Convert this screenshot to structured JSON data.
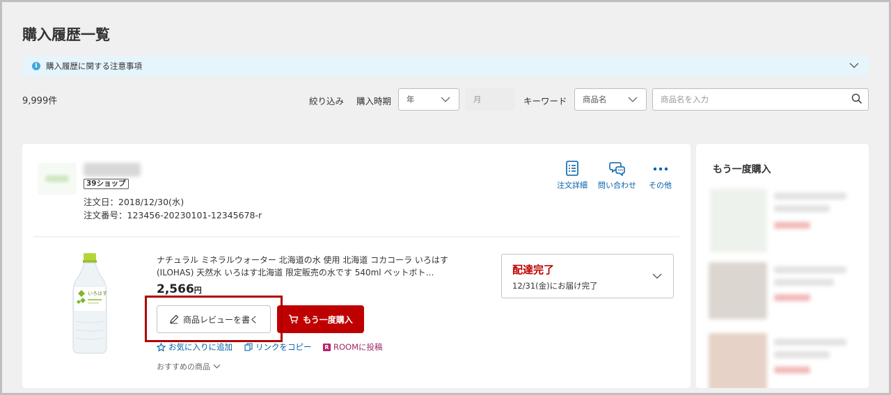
{
  "page": {
    "title": "購入履歴一覧"
  },
  "notice": {
    "text": "購入履歴に関する注意事項"
  },
  "count": "9,999件",
  "filters": {
    "narrow_label": "絞り込み",
    "period_label": "購入時期",
    "year_value": "年",
    "month_value": "月",
    "keyword_label": "キーワード",
    "keyword_type": "商品名",
    "search_placeholder": "商品名を入力"
  },
  "order": {
    "shop_badge": "39ショップ",
    "date": "注文日：2018/12/30(水)",
    "number": "注文番号：123456-20230101-12345678-r",
    "actions": [
      {
        "label": "注文詳細",
        "icon": "document-icon"
      },
      {
        "label": "問い合わせ",
        "icon": "chat-icon"
      },
      {
        "label": "その他",
        "icon": "more-icon"
      }
    ],
    "item": {
      "name": "ナチュラル ミネラルウォーター 北海道の水 使用 北海道 コカコーラ いろはす(ILOHAS) 天然水 いろはす北海道 限定販売の水です 540ml ペットボト…",
      "price": "2,566",
      "price_unit": "円",
      "bottle_label": "いろはす",
      "review_button": "商品レビューを書く",
      "rebuy_button": "もう一度購入",
      "favorite_link": "お気に入りに追加",
      "copy_link": "リンクをコピー",
      "room_link": "ROOMに投稿",
      "room_icon_letter": "R",
      "recommend": "おすすめの商品"
    },
    "status": {
      "title": "配達完了",
      "detail": "12/31(金)にお届け完了"
    }
  },
  "sidebar": {
    "title": "もう一度購入"
  },
  "colors": {
    "accent_red": "#bf0000",
    "link_blue": "#0060a8",
    "notice_bg": "#e6f4fb"
  }
}
